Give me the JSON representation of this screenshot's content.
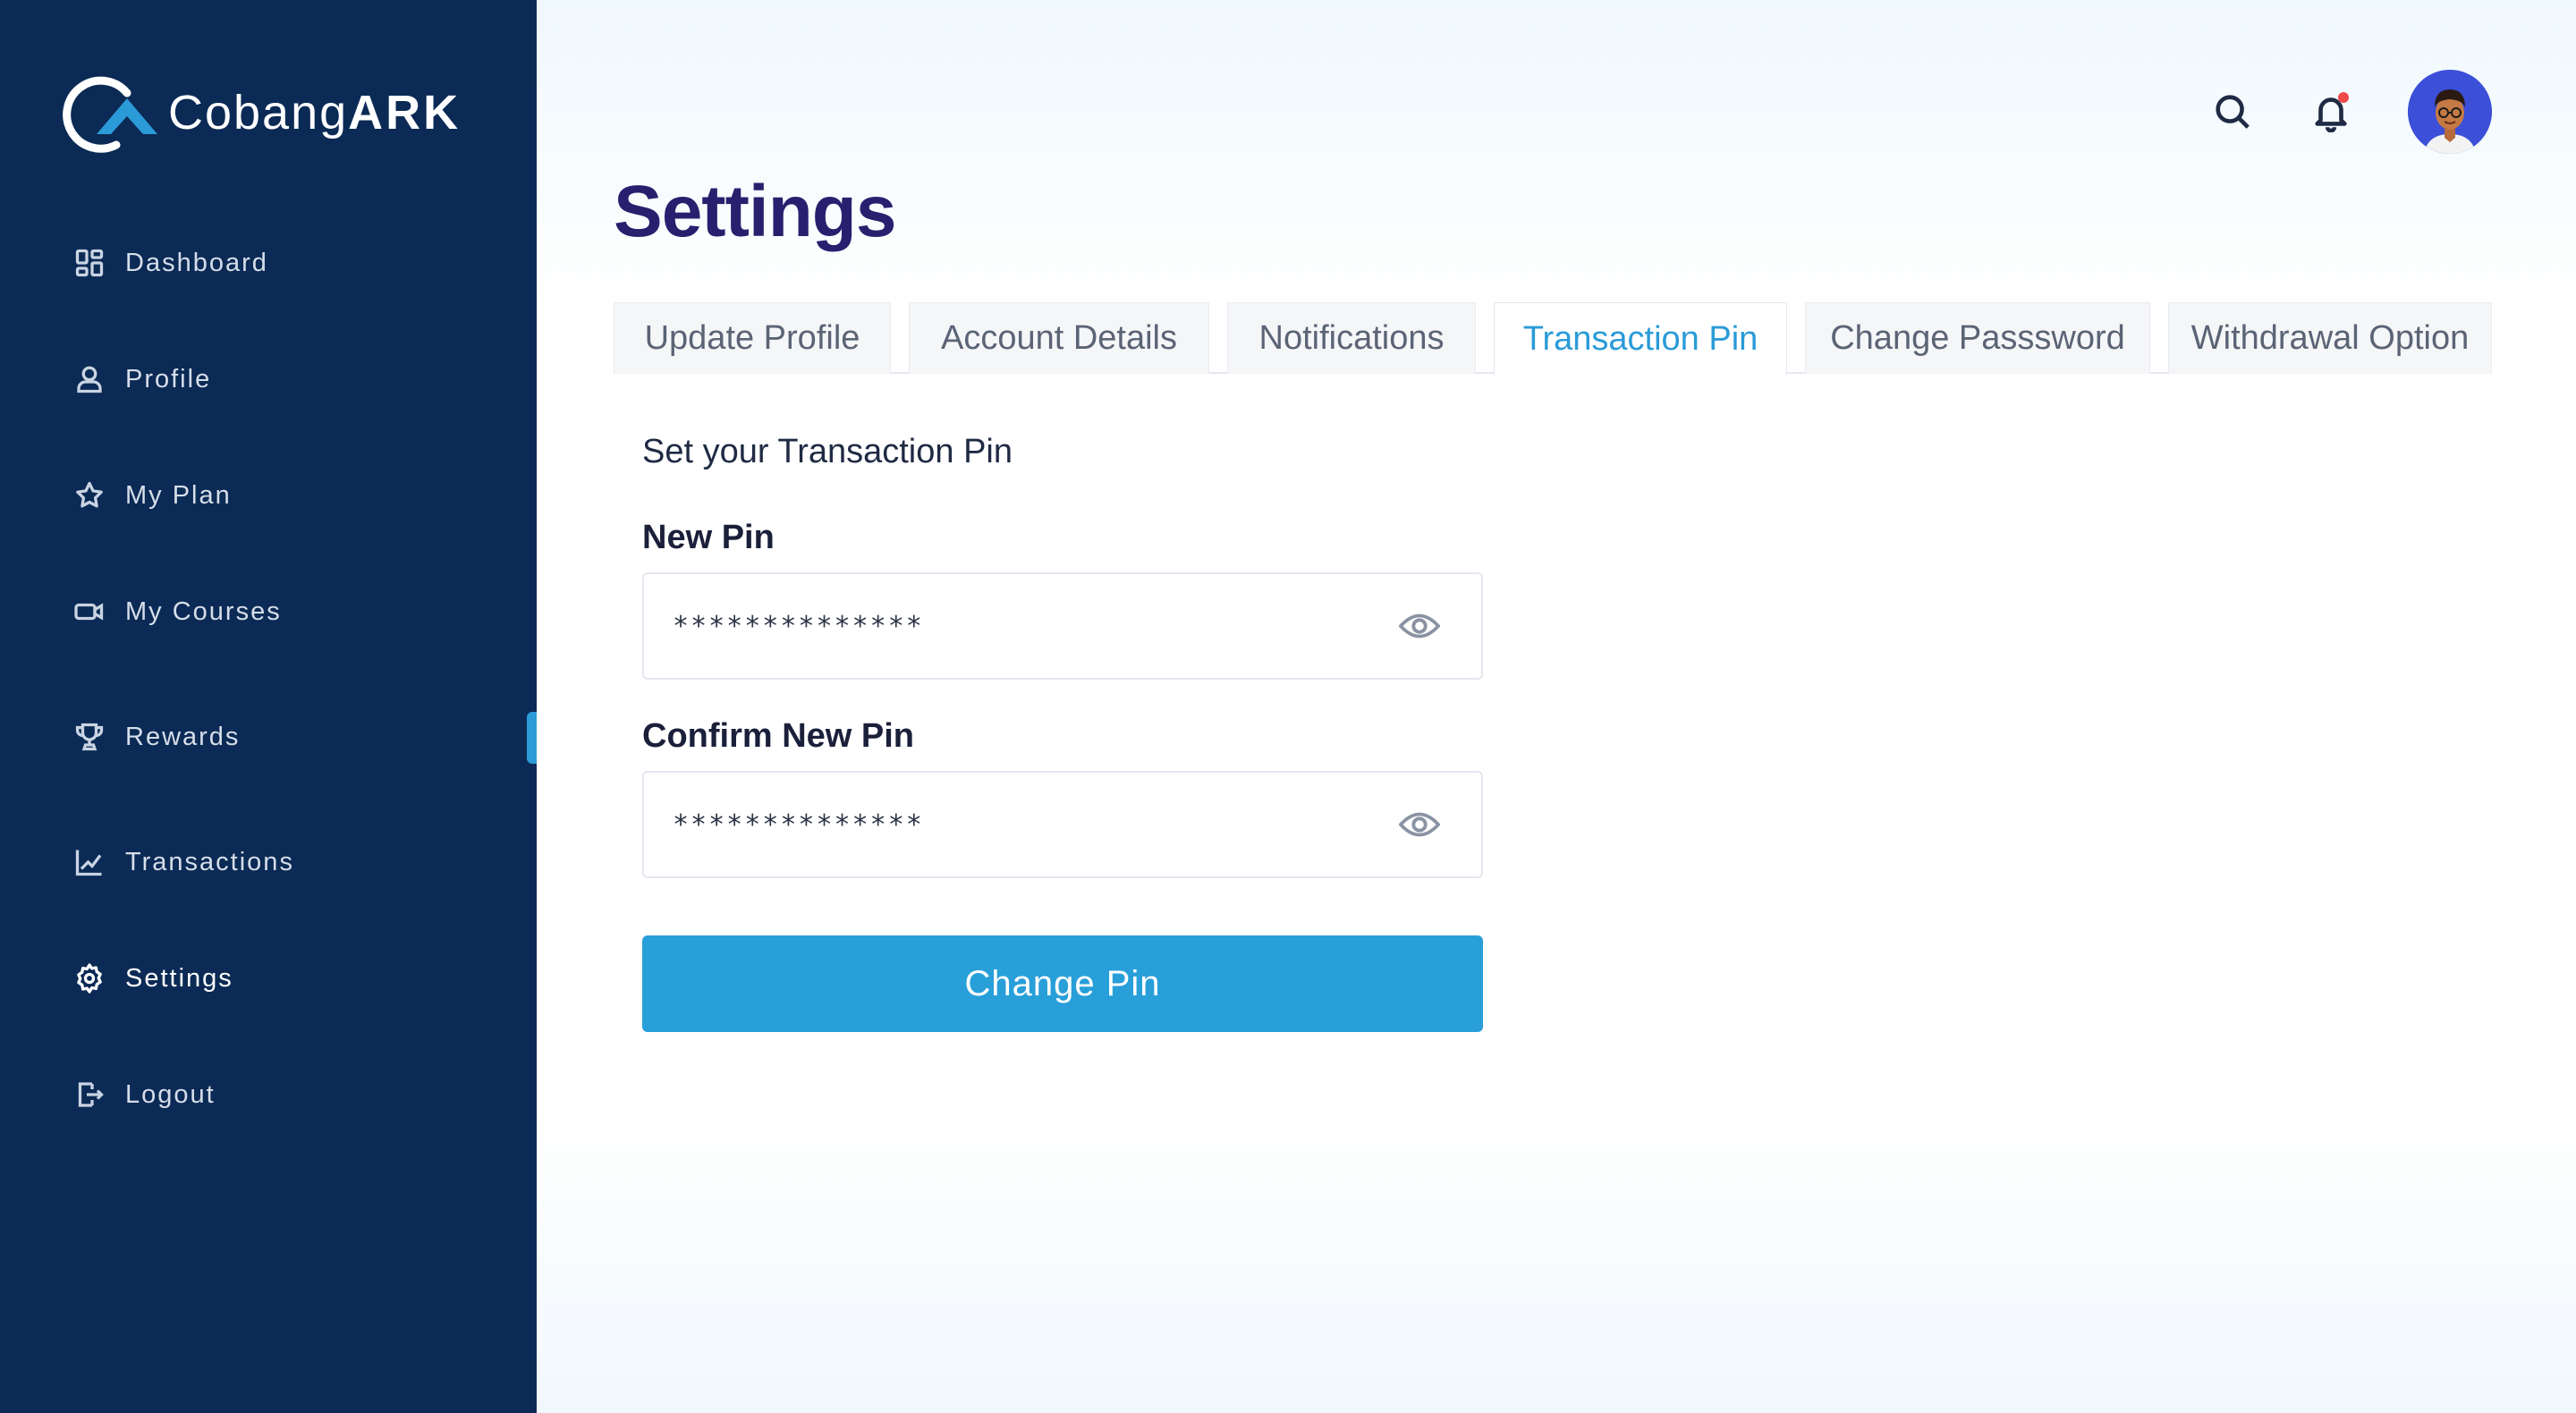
{
  "brand": {
    "name_regular": "Cobang",
    "name_bold": "ARK"
  },
  "sidebar": {
    "items": [
      {
        "label": "Dashboard",
        "icon": "dashboard-grid-icon"
      },
      {
        "label": "Profile",
        "icon": "user-icon"
      },
      {
        "label": "My Plan",
        "icon": "star-icon"
      },
      {
        "label": "My Courses",
        "icon": "video-camera-icon"
      },
      {
        "label": "Rewards",
        "icon": "trophy-icon"
      },
      {
        "label": "Transactions",
        "icon": "line-chart-icon"
      },
      {
        "label": "Settings",
        "icon": "gear-icon",
        "active": true
      },
      {
        "label": "Logout",
        "icon": "logout-icon"
      }
    ]
  },
  "header": {
    "notification_dot": true
  },
  "page": {
    "title": "Settings"
  },
  "tabs": [
    {
      "label": "Update Profile"
    },
    {
      "label": "Account Details"
    },
    {
      "label": "Notifications"
    },
    {
      "label": "Transaction Pin",
      "active": true
    },
    {
      "label": "Change Passsword"
    },
    {
      "label": "Withdrawal Option"
    }
  ],
  "form": {
    "heading": "Set your Transaction Pin",
    "new_pin": {
      "label": "New Pin",
      "value": "**************"
    },
    "confirm_pin": {
      "label": "Confirm New Pin",
      "value": "**************"
    },
    "submit_label": "Change Pin"
  },
  "colors": {
    "sidebar_bg": "#0b2a55",
    "accent": "#289fd9",
    "title": "#2a1f6e",
    "notification_dot": "#ef4a4a"
  }
}
